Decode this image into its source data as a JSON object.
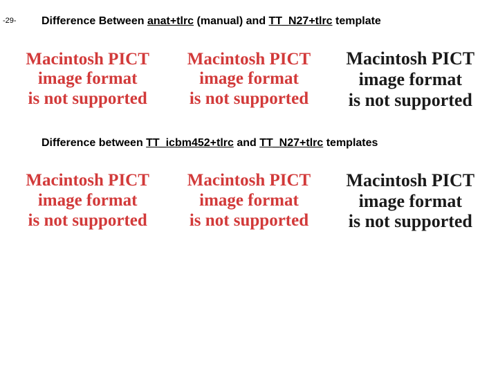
{
  "page_number": "-29-",
  "heading1": {
    "prefix": "Difference Between ",
    "term1": "anat+tlrc",
    "mid": " (manual) and ",
    "term2": "TT_N27+tlrc",
    "suffix": " template"
  },
  "heading2": {
    "prefix": "Difference between ",
    "term1": "TT_icbm452+tlrc",
    "mid": " and ",
    "term2": "TT_N27+tlrc",
    "suffix": " templates"
  },
  "placeholder": {
    "line1": "Macintosh PICT",
    "line2": "image format",
    "line3": "is not supported"
  }
}
